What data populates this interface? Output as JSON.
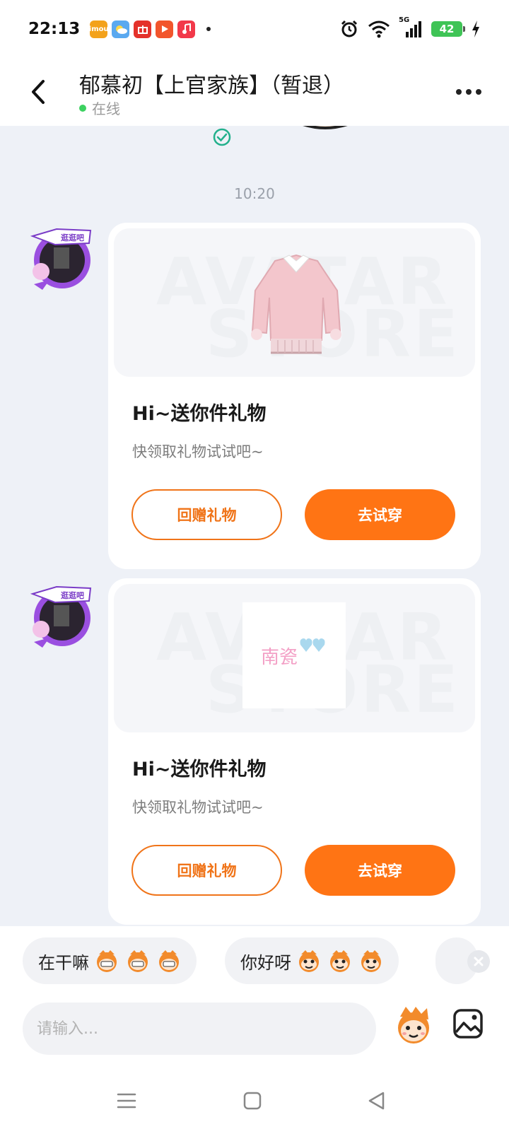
{
  "status_bar": {
    "time": "22:13",
    "network": "5G",
    "battery": "42",
    "app_icons": [
      "imou-icon",
      "weather-icon",
      "gift-app-icon",
      "video-app-icon",
      "music-app-icon"
    ]
  },
  "header": {
    "title": "郁慕初【上官家族】（暂退）",
    "status": "在线",
    "status_color": "#3cd160"
  },
  "chat": {
    "timestamp": "10:20",
    "messages": [
      {
        "type": "gift",
        "watermark_line1": "AVATAR",
        "watermark_line2": "STORE",
        "item": "pink-sweater-outfit",
        "title": "Hi~送你件礼物",
        "subtitle": "快领取礼物试试吧~",
        "return_gift_label": "回赠礼物",
        "try_on_label": "去试穿"
      },
      {
        "type": "gift",
        "watermark_line1": "AVATAR",
        "watermark_line2": "STORE",
        "item_text": "南瓷",
        "title": "Hi~送你件礼物",
        "subtitle": "快领取礼物试试吧~",
        "return_gift_label": "回赠礼物",
        "try_on_label": "去试穿"
      }
    ]
  },
  "quick_replies": [
    {
      "text": "在干嘛"
    },
    {
      "text": "你好呀"
    }
  ],
  "input": {
    "placeholder": "请输入..."
  },
  "colors": {
    "accent": "#ff7414",
    "background": "#eef1f7"
  }
}
